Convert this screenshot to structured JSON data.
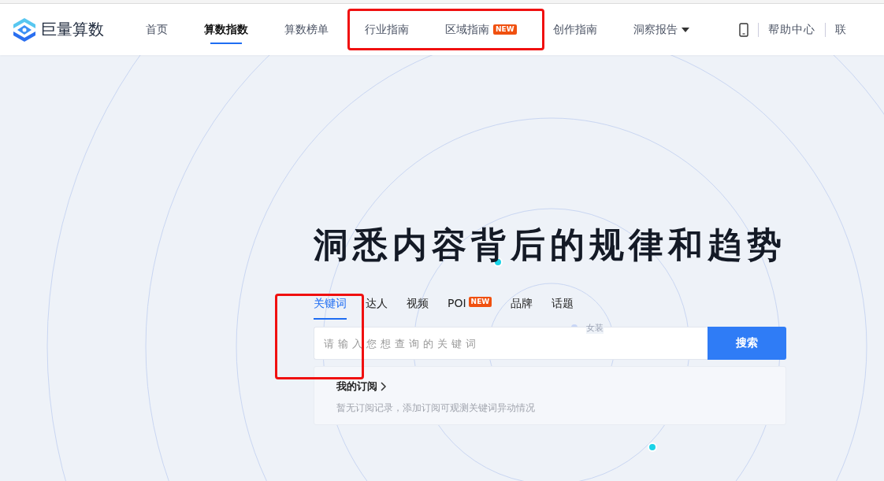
{
  "brand": {
    "name": "巨量算数"
  },
  "nav": {
    "items": [
      {
        "label": "首页",
        "selected": false
      },
      {
        "label": "算数指数",
        "selected": true
      },
      {
        "label": "算数榜单",
        "selected": false
      },
      {
        "label": "行业指南",
        "selected": false
      },
      {
        "label": "区域指南",
        "selected": false,
        "badge": "NEW"
      },
      {
        "label": "创作指南",
        "selected": false
      },
      {
        "label": "洞察报告",
        "selected": false,
        "dropdown": true
      }
    ],
    "links": [
      "帮助中心",
      "联"
    ]
  },
  "hero": {
    "title": "洞悉内容背后的规律和趋势",
    "floating_keywords": [
      "女装"
    ],
    "search_tabs": [
      {
        "label": "关键词",
        "selected": true
      },
      {
        "label": "达人",
        "selected": false
      },
      {
        "label": "视频",
        "selected": false
      },
      {
        "label": "POI",
        "selected": false,
        "badge": "NEW"
      },
      {
        "label": "品牌",
        "selected": false
      },
      {
        "label": "话题",
        "selected": false
      }
    ],
    "search": {
      "placeholder": "请输入您想查询的关键词",
      "button": "搜索"
    },
    "subscription": {
      "title": "我的订阅",
      "message": "暂无订阅记录，添加订阅可观测关键词异动情况"
    }
  }
}
